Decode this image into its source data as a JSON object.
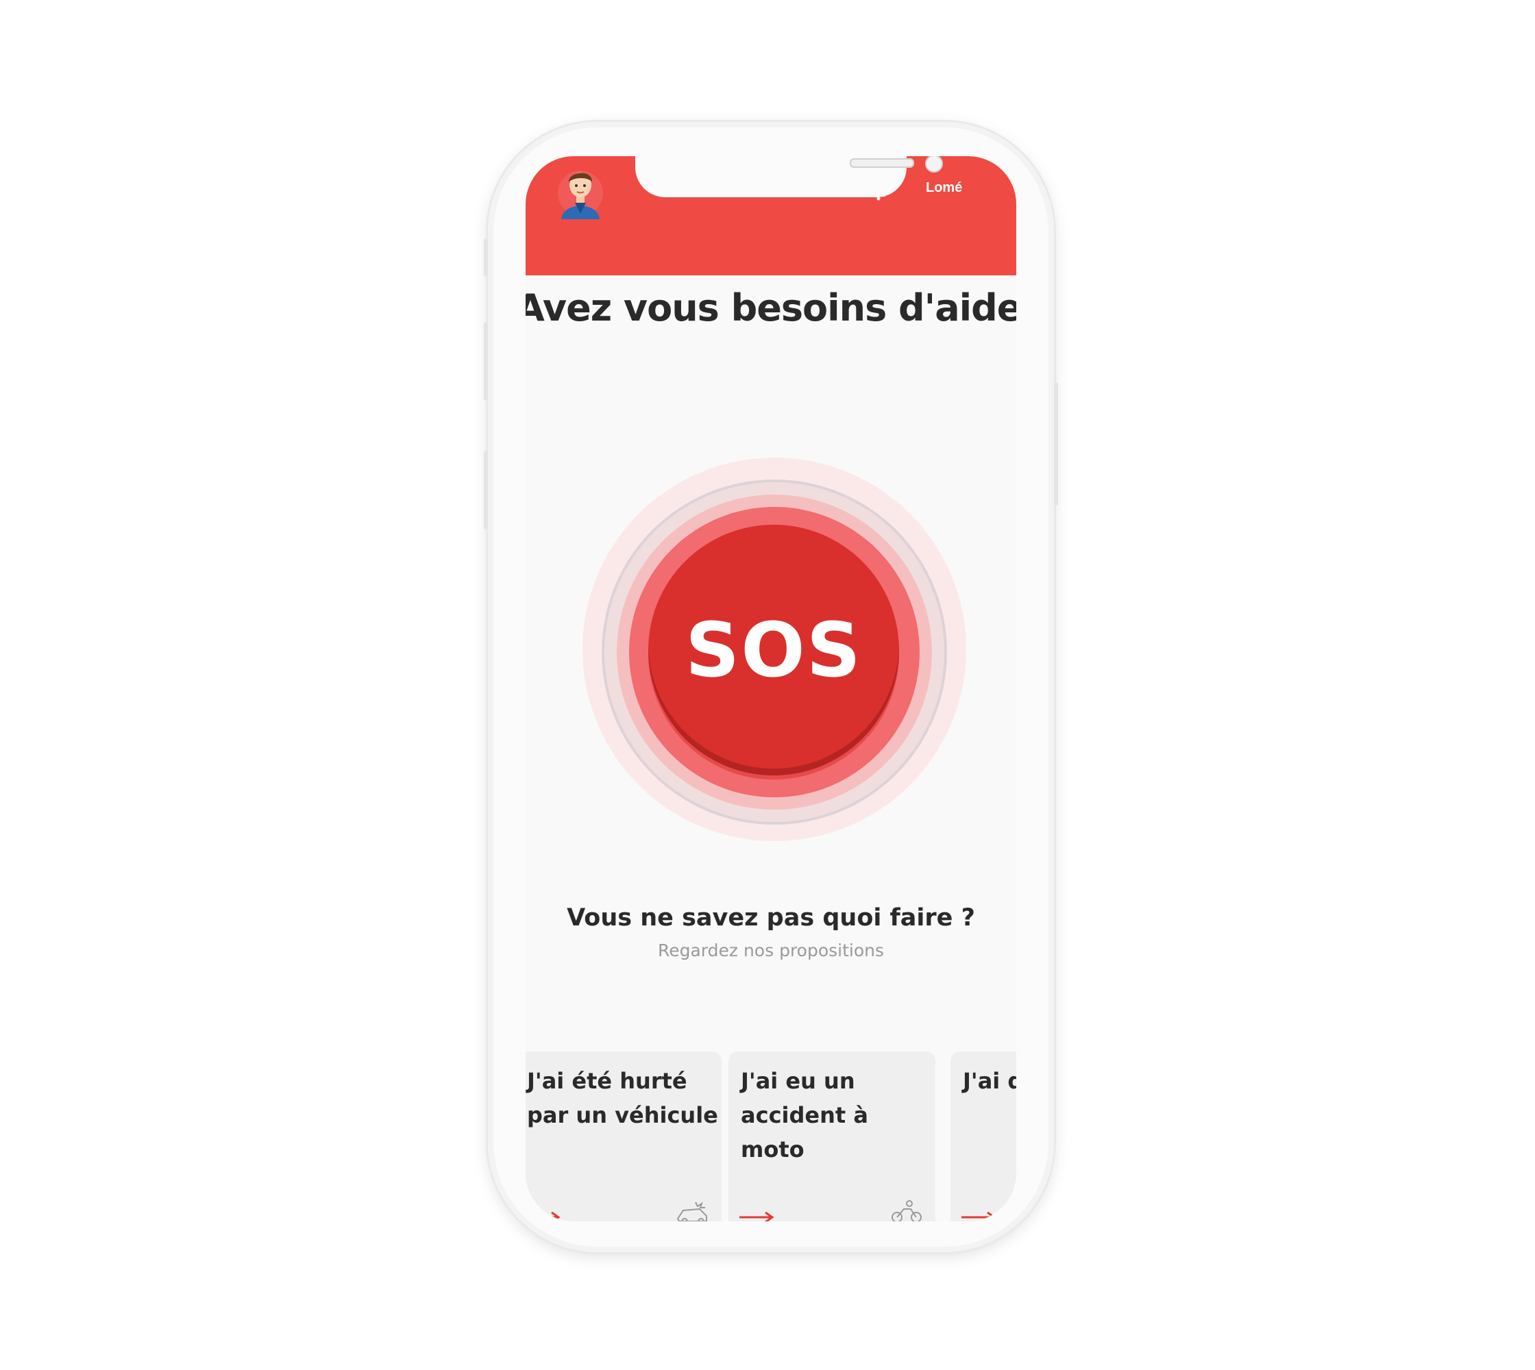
{
  "header": {
    "city": "Lomé",
    "accent_color": "#ef4a44",
    "avatar_icon": "user-avatar",
    "notification_icon": "bell-icon"
  },
  "main": {
    "title": "Avez vous besoins d'aide ?",
    "sos_label": "SOS",
    "sos_color": "#d9302d",
    "help_title": "Vous ne savez pas quoi faire ?",
    "help_subtitle": "Regardez nos propositions"
  },
  "cards": [
    {
      "label": "J'ai été hurté par un véhicule",
      "icon": "car-crash-icon"
    },
    {
      "label": "J'ai eu un accident à moto",
      "icon": "moto-accident-icon"
    },
    {
      "label": "J'ai des maux",
      "icon": "arrow-right-icon"
    }
  ]
}
